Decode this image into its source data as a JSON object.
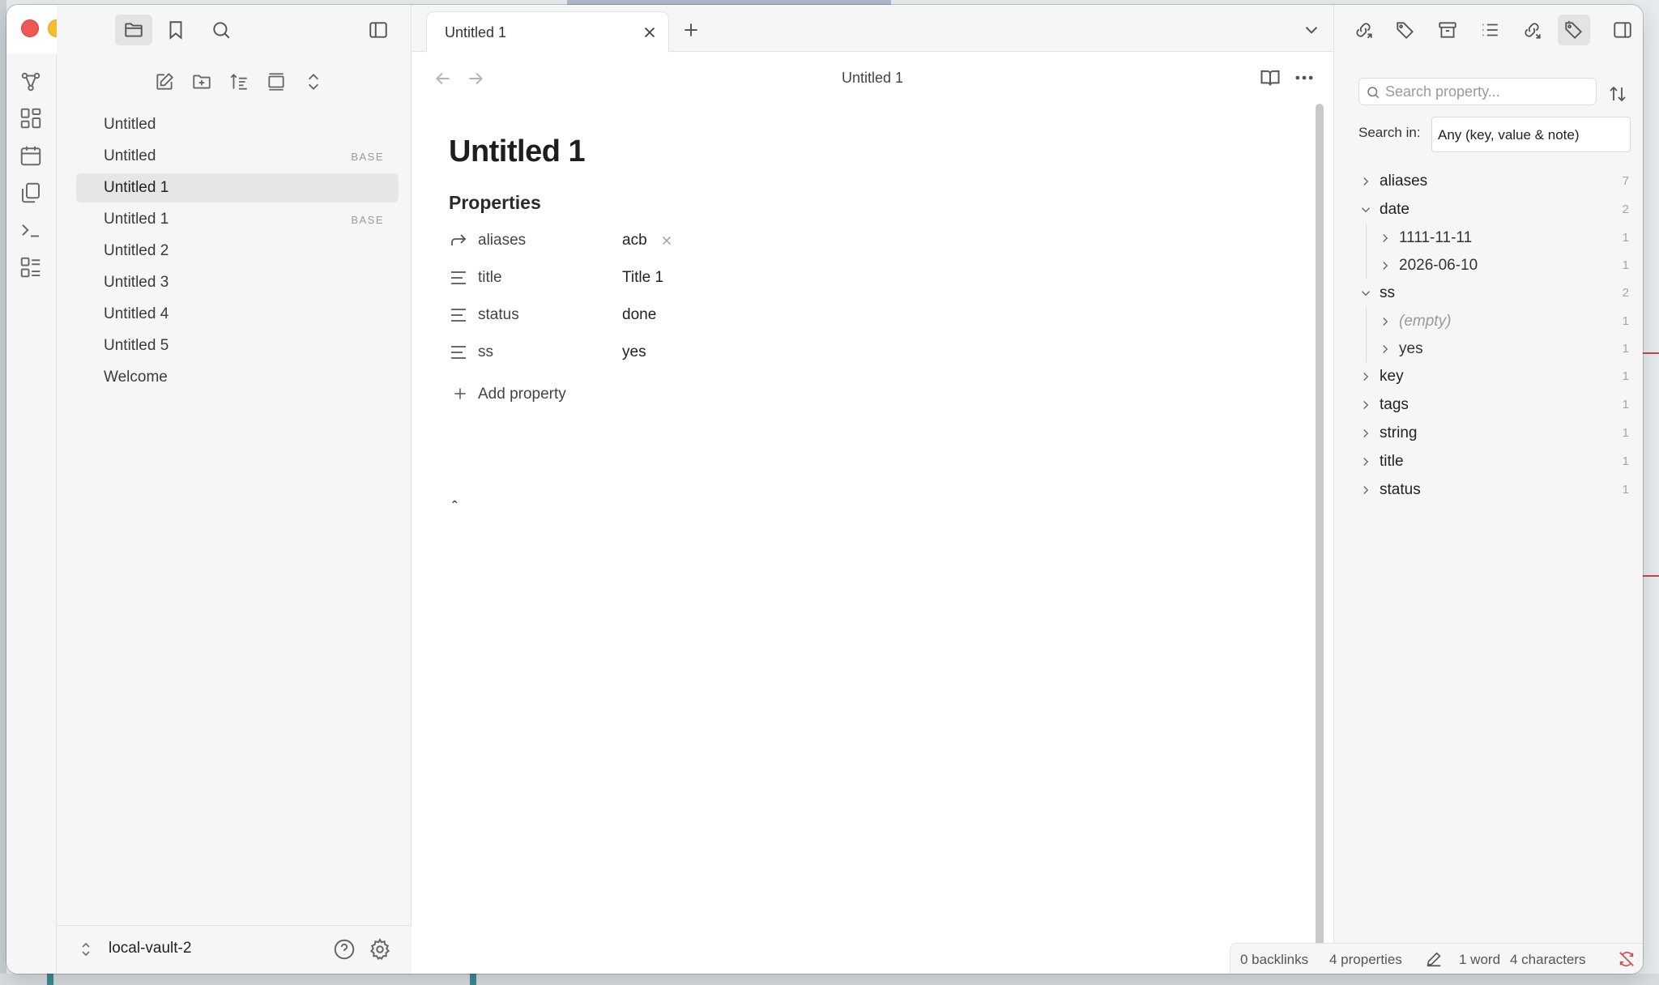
{
  "window": {
    "accent": "#7b6cd9"
  },
  "ribbon": {
    "icons": [
      "graph-icon",
      "canvas-icon",
      "calendar-icon",
      "copy-icon",
      "terminal-icon",
      "bases-icon"
    ]
  },
  "sidebar": {
    "top_buttons": [
      "folder-icon",
      "bookmark-icon",
      "search-icon",
      "sidebar-toggle-icon"
    ],
    "nav_actions": [
      "new-note-icon",
      "new-folder-icon",
      "sort-icon",
      "collapse-icon",
      "expand-icon"
    ],
    "files": [
      {
        "name": "Untitled",
        "badge": ""
      },
      {
        "name": "Untitled",
        "badge": "BASE"
      },
      {
        "name": "Untitled 1",
        "badge": "",
        "active": true
      },
      {
        "name": "Untitled 1",
        "badge": "BASE"
      },
      {
        "name": "Untitled 2",
        "badge": ""
      },
      {
        "name": "Untitled 3",
        "badge": ""
      },
      {
        "name": "Untitled 4",
        "badge": ""
      },
      {
        "name": "Untitled 5",
        "badge": ""
      },
      {
        "name": "Welcome",
        "badge": ""
      }
    ],
    "vault_name": "local-vault-2"
  },
  "tabs": {
    "active_title": "Untitled 1"
  },
  "view": {
    "title": "Untitled 1"
  },
  "doc": {
    "title": "Untitled 1",
    "properties_heading": "Properties",
    "properties": [
      {
        "key": "aliases",
        "value": "acb",
        "icon": "alias-arrow-icon"
      },
      {
        "key": "title",
        "value": "Title 1",
        "icon": "text-lines-icon"
      },
      {
        "key": "status",
        "value": "done",
        "icon": "text-lines-icon"
      },
      {
        "key": "ss",
        "value": "yes",
        "icon": "text-lines-icon"
      }
    ],
    "add_property": "Add property",
    "caret_text": "ˆ"
  },
  "right_panel": {
    "search_placeholder": "Search property...",
    "search_in_label": "Search in:",
    "search_in_value": "Any (key, value & note)",
    "tree": [
      {
        "label": "aliases",
        "count": "7",
        "expanded": false
      },
      {
        "label": "date",
        "count": "2",
        "expanded": true,
        "children": [
          {
            "label": "1111-11-11",
            "count": "1"
          },
          {
            "label": "2026-06-10",
            "count": "1"
          }
        ]
      },
      {
        "label": "ss",
        "count": "2",
        "expanded": true,
        "children": [
          {
            "label": "(empty)",
            "count": "1",
            "empty": true
          },
          {
            "label": "yes",
            "count": "1"
          }
        ]
      },
      {
        "label": "key",
        "count": "1",
        "expanded": false
      },
      {
        "label": "tags",
        "count": "1",
        "expanded": false
      },
      {
        "label": "string",
        "count": "1",
        "expanded": false
      },
      {
        "label": "title",
        "count": "1",
        "expanded": false
      },
      {
        "label": "status",
        "count": "1",
        "expanded": false
      }
    ]
  },
  "status_bar": {
    "backlinks": "0 backlinks",
    "properties": "4 properties",
    "words": "1 word",
    "characters": "4 characters",
    "sync_color": "#e0454b"
  }
}
